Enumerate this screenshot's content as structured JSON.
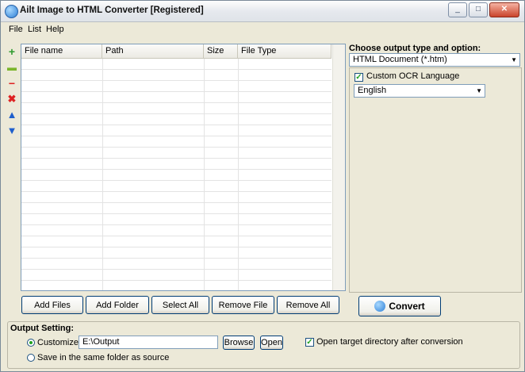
{
  "window": {
    "title": "Ailt Image to HTML Converter [Registered]",
    "controls": {
      "minimize": "_",
      "maximize": "□",
      "close": "✕"
    }
  },
  "menu": [
    "File",
    "List",
    "Help"
  ],
  "toolbar_icons": [
    "add-file-icon",
    "add-folder-icon",
    "remove-icon",
    "remove-all-icon",
    "move-up-icon",
    "move-down-icon"
  ],
  "file_list": {
    "columns": [
      "File name",
      "Path",
      "Size",
      "File Type"
    ],
    "rows": []
  },
  "buttons": {
    "add_files": "Add Files",
    "add_folder": "Add Folder",
    "select_all": "Select All",
    "remove_file": "Remove File",
    "remove_all": "Remove All",
    "convert": "Convert"
  },
  "output_type": {
    "label": "Choose output type and option:",
    "selected": "HTML Document (*.htm)",
    "ocr_checkbox_label": "Custom OCR Language",
    "ocr_checked": true,
    "language": "English"
  },
  "output_setting": {
    "title": "Output Setting:",
    "customize_label": "Customize",
    "customize_selected": true,
    "path": "E:\\Output",
    "browse": "Browse",
    "open": "Open",
    "open_after_label": "Open target directory after conversion",
    "open_after_checked": true,
    "same_folder_label": "Save in the same folder as source"
  },
  "colors": {
    "accent": "#003c74",
    "check": "#21a121"
  }
}
